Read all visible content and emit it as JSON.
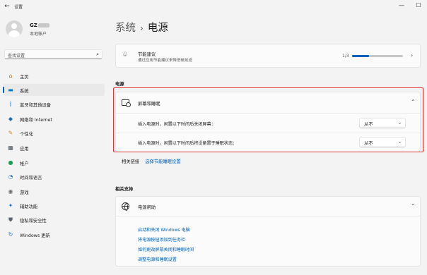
{
  "window": {
    "back": "←",
    "title": "设置",
    "minimize": "—",
    "maximize": "☐"
  },
  "user": {
    "name": "GZ",
    "type": "本地帐户"
  },
  "search": {
    "placeholder": "查找设置",
    "icon": "⌕"
  },
  "nav": [
    {
      "label": "主页",
      "icon": "⌂",
      "color": "#c4651c"
    },
    {
      "label": "系统",
      "icon": "▬",
      "color": "#0078d4"
    },
    {
      "label": "蓝牙和其他设备",
      "icon": "ᛒ",
      "color": "#0078d4"
    },
    {
      "label": "网络和 Internet",
      "icon": "◆",
      "color": "#1f6fb5"
    },
    {
      "label": "个性化",
      "icon": "✎",
      "color": "#d08a2c"
    },
    {
      "label": "应用",
      "icon": "▦",
      "color": "#4a5560"
    },
    {
      "label": "帐户",
      "icon": "●",
      "color": "#1e9e5a"
    },
    {
      "label": "时间和语言",
      "icon": "◔",
      "color": "#2a7fd4"
    },
    {
      "label": "游戏",
      "icon": "◉",
      "color": "#6b6b6b"
    },
    {
      "label": "辅助功能",
      "icon": "✦",
      "color": "#1a73c6"
    },
    {
      "label": "隐私和安全性",
      "icon": "⛊",
      "color": "#5a6570"
    },
    {
      "label": "Windows 更新",
      "icon": "↻",
      "color": "#1a73c6"
    }
  ],
  "breadcrumb": {
    "parent": "系统",
    "separator": "›",
    "current": "电源"
  },
  "energy": {
    "title": "节能建议",
    "subtitle": "通过应用节能建议来降低碳足迹",
    "count": "1/3",
    "progress": 0.333,
    "chevron": "›"
  },
  "power_section": {
    "label": "电源",
    "screen_title": "屏幕和睡眠",
    "chevron": "⌃",
    "rows": [
      {
        "label": "插入电源时，闲置以下时间后关闭屏幕：",
        "value": "从不"
      },
      {
        "label": "插入电源时，闲置以下时间后将设备置于睡眠状态：",
        "value": "从不"
      }
    ],
    "caret": "⌄"
  },
  "related": {
    "label": "相关链接",
    "link": "选择节能睡眠设置"
  },
  "support": {
    "section_label": "相关支持",
    "title": "电源帮助",
    "chevron": "⌃",
    "links": [
      "启动和关闭 Windows 电脑",
      "将电源按钮添加到任务栏",
      "如何更改屏幕关闭和睡眠时间",
      "调整电源和睡眠设置"
    ]
  },
  "colors": {
    "accent": "#005fb8",
    "highlight": "#e13333"
  }
}
